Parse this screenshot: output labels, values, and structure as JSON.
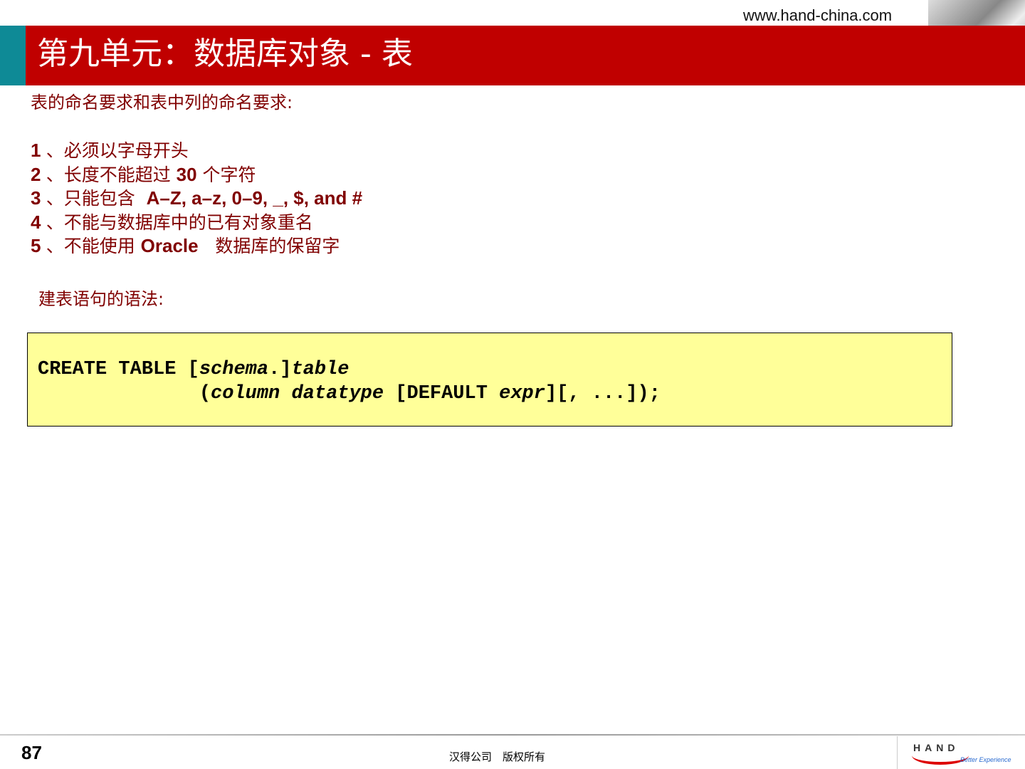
{
  "header": {
    "url": "www.hand-china.com",
    "title": "第九单元：数据库对象 - 表"
  },
  "intro": "表的命名要求和表中列的命名要求:",
  "rules": [
    {
      "num": "1",
      "parts": [
        {
          "t": "、必须以字母开头"
        }
      ]
    },
    {
      "num": "2",
      "parts": [
        {
          "t": "、长度不能超过 "
        },
        {
          "t": "30",
          "b": true
        },
        {
          "t": " 个字符"
        }
      ]
    },
    {
      "num": "3",
      "parts": [
        {
          "t": "、只能包含  "
        },
        {
          "t": "A–Z, a–z, 0–9, _, $, and #",
          "b": true
        }
      ]
    },
    {
      "num": "4",
      "parts": [
        {
          "t": "、不能与数据库中的已有对象重名"
        }
      ]
    },
    {
      "num": "5",
      "parts": [
        {
          "t": "、不能使用 "
        },
        {
          "t": "Oracle",
          "b": true
        },
        {
          "t": "   数据库的保留字"
        }
      ]
    }
  ],
  "syntax_label": "建表语句的语法:",
  "code": {
    "line1": [
      {
        "t": "CREATE TABLE ["
      },
      {
        "t": "schema",
        "i": true
      },
      {
        "t": ".]"
      },
      {
        "t": "table",
        "i": true
      }
    ],
    "line2": [
      {
        "t": "              ("
      },
      {
        "t": "column datatype",
        "i": true
      },
      {
        "t": " [DEFAULT "
      },
      {
        "t": "expr",
        "i": true
      },
      {
        "t": "][, ...]);"
      }
    ]
  },
  "footer": {
    "page": "87",
    "copyright": "汉得公司　版权所有",
    "logo_text": "HAND",
    "logo_tagline": "Better Experience"
  },
  "colors": {
    "title_bar": "#c00000",
    "accent": "#0e8a96",
    "text": "#800000",
    "code_bg": "#ffff99"
  }
}
